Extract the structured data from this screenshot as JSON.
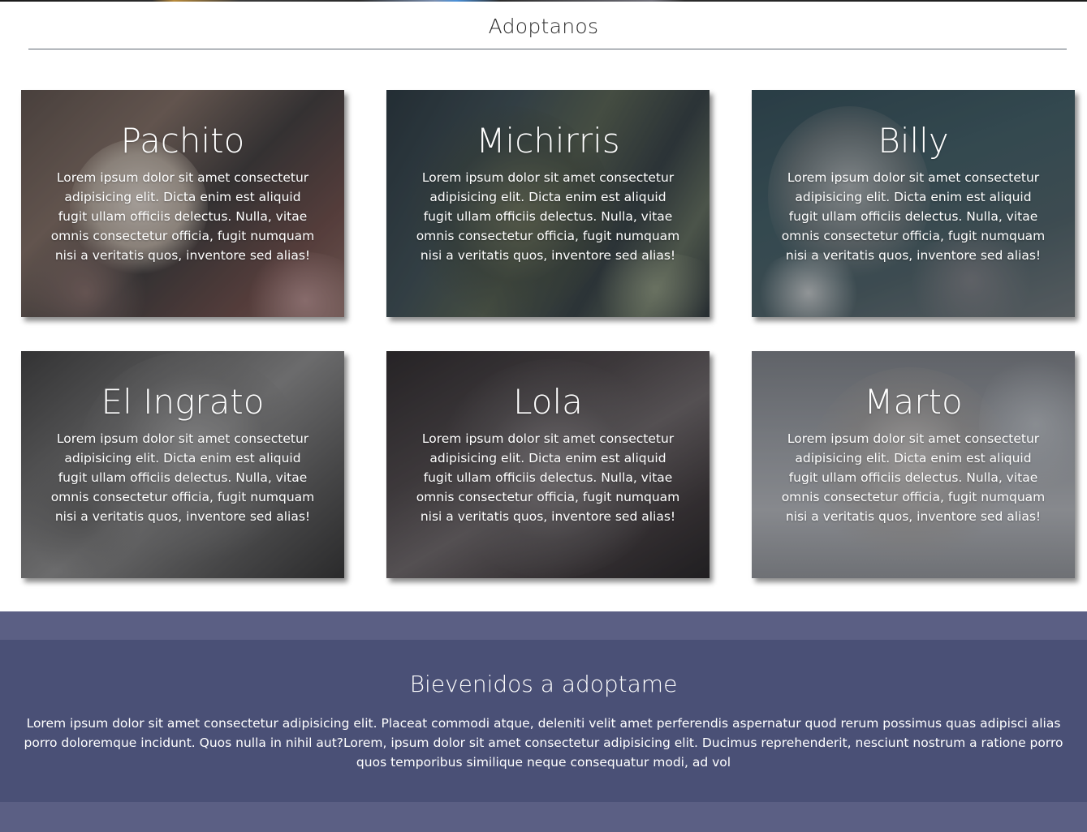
{
  "page": {
    "section_title": "Adoptanos"
  },
  "cards": [
    {
      "name": "Pachito",
      "description": "Lorem ipsum dolor sit amet consectetur adipisicing elit. Dicta enim est aliquid fugit ullam officiis delectus. Nulla, vitae omnis consectetur officia, fugit numquam nisi a veritatis quos, inventore sed alias!"
    },
    {
      "name": "Michirris",
      "description": "Lorem ipsum dolor sit amet consectetur adipisicing elit. Dicta enim est aliquid fugit ullam officiis delectus. Nulla, vitae omnis consectetur officia, fugit numquam nisi a veritatis quos, inventore sed alias!"
    },
    {
      "name": "Billy",
      "description": "Lorem ipsum dolor sit amet consectetur adipisicing elit. Dicta enim est aliquid fugit ullam officiis delectus. Nulla, vitae omnis consectetur officia, fugit numquam nisi a veritatis quos, inventore sed alias!"
    },
    {
      "name": "El Ingrato",
      "description": "Lorem ipsum dolor sit amet consectetur adipisicing elit. Dicta enim est aliquid fugit ullam officiis delectus. Nulla, vitae omnis consectetur officia, fugit numquam nisi a veritatis quos, inventore sed alias!"
    },
    {
      "name": "Lola",
      "description": "Lorem ipsum dolor sit amet consectetur adipisicing elit. Dicta enim est aliquid fugit ullam officiis delectus. Nulla, vitae omnis consectetur officia, fugit numquam nisi a veritatis quos, inventore sed alias!"
    },
    {
      "name": "Marto",
      "description": "Lorem ipsum dolor sit amet consectetur adipisicing elit. Dicta enim est aliquid fugit ullam officiis delectus. Nulla, vitae omnis consectetur officia, fugit numquam nisi a veritatis quos, inventore sed alias!"
    }
  ],
  "welcome": {
    "title": "Bievenidos a adoptame",
    "text": "Lorem ipsum dolor sit amet consectetur adipisicing elit. Placeat commodi atque, deleniti velit amet perferendis aspernatur quod rerum possimus quas adipisci alias porro doloremque incidunt. Quos nulla in nihil aut?Lorem, ipsum dolor sit amet consectetur adipisicing elit. Ducimus reprehenderit, nesciunt nostrum a ratione porro quos temporibus similique neque consequatur modi, ad vol"
  },
  "colors": {
    "band_light": "#5b5f84",
    "band_dark": "#4a5076",
    "rule": "#5d6670"
  }
}
